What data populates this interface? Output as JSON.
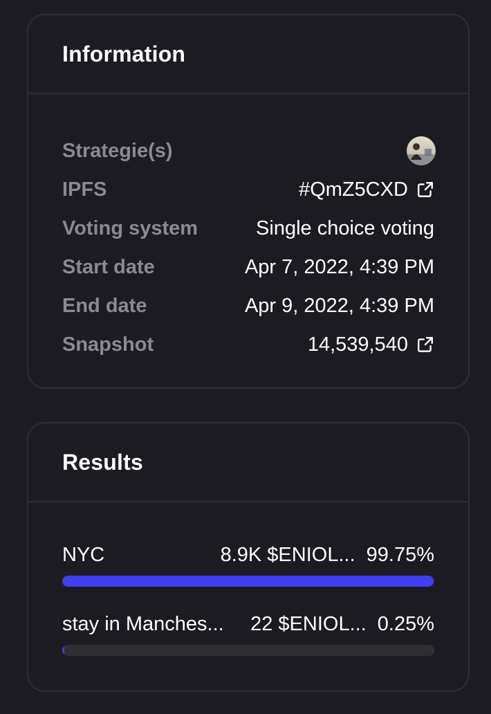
{
  "information": {
    "title": "Information",
    "rows": [
      {
        "label": "Strategie(s)",
        "value": "",
        "type": "avatar",
        "icon": "strategy-avatar-icon"
      },
      {
        "label": "IPFS",
        "value": "#QmZ5CXD",
        "type": "link",
        "icon": "external-link-icon"
      },
      {
        "label": "Voting system",
        "value": "Single choice voting",
        "type": "text"
      },
      {
        "label": "Start date",
        "value": "Apr 7, 2022, 4:39 PM",
        "type": "text"
      },
      {
        "label": "End date",
        "value": "Apr 9, 2022, 4:39 PM",
        "type": "text"
      },
      {
        "label": "Snapshot",
        "value": "14,539,540",
        "type": "link",
        "icon": "external-link-icon"
      }
    ]
  },
  "results": {
    "title": "Results",
    "items": [
      {
        "name": "NYC",
        "amount": "8.9K $ENIOL...",
        "percent": "99.75%",
        "fraction": 0.9975
      },
      {
        "name": "stay in Manches...",
        "amount": "22 $ENIOL...",
        "percent": "0.25%",
        "fraction": 0.0025
      }
    ]
  },
  "colors": {
    "background": "#1c1b22",
    "border": "#2d2d35",
    "label": "#8b8a93",
    "bar_fill": "#3f3ff0",
    "bar_track": "#2e2e33"
  }
}
